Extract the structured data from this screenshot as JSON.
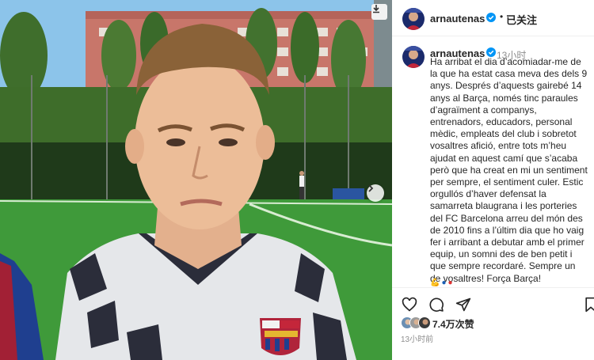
{
  "post": {
    "username": "arnautenas",
    "follow_label": "已关注",
    "separator": "•",
    "relative_time": "13小时",
    "caption": "Ha arribat el dia d’acomiadar-me de la que ha estat casa meva des dels 9 anys. Després d’aquests gairebé 14 anys al Barça, només tinc paraules d’agraïment a companys, entrenadors, educadors, personal mèdic, empleats del club i sobretot vosaltres afició, entre tots m’heu ajudat en aquest camí que s’acaba però que ha creat en mi un sentiment per sempre, el sentiment culer. Estic orgullós d’haver defensat la samarreta blaugrana i les porteries del FC Barcelona arreu del món des de 2010 fins a l’últim dia que ho vaig fer i arribant a debutar amb el primer equip, un somni des de ben petit i que sempre recordaré. Sempre un de vosaltres! Força Barça!",
    "likes": "7.4万次赞",
    "timestamp": "13小时前"
  },
  "icons": {
    "verified": "verified-badge-icon",
    "like": "heart-icon",
    "comment": "comment-bubble-icon",
    "share": "paper-plane-icon",
    "save": "bookmark-icon",
    "next": "chevron-right-icon",
    "download": "download-icon"
  },
  "colors": {
    "verified_blue": "#0095f6",
    "text": "#262626",
    "muted": "#8e8e8e",
    "divider": "#efefef"
  }
}
